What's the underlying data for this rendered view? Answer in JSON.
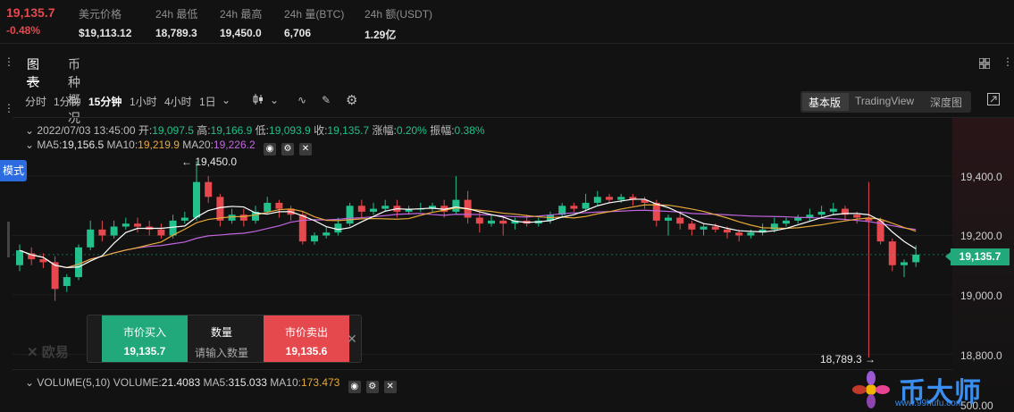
{
  "ticker": {
    "last_price": "19,135.7",
    "change_pct": "-0.48%",
    "stats": [
      {
        "label": "美元价格",
        "value": "$19,113.12"
      },
      {
        "label": "24h 最低",
        "value": "18,789.3"
      },
      {
        "label": "24h 最高",
        "value": "19,450.0"
      },
      {
        "label": "24h 量(BTC)",
        "value": "6,706"
      },
      {
        "label": "24h 额(USDT)",
        "value": "1.29亿"
      }
    ]
  },
  "tabs": [
    "图表",
    "币种概况"
  ],
  "intervals": [
    "分时",
    "1分钟",
    "15分钟",
    "1小时",
    "4小时",
    "1日"
  ],
  "view_modes": [
    "基本版",
    "TradingView",
    "深度图"
  ],
  "candle_info": {
    "datetime": "2022/07/03 13:45:00",
    "open_label": "开:",
    "open": "19,097.5",
    "high_label": "高:",
    "high": "19,166.9",
    "low_label": "低:",
    "low": "19,093.9",
    "close_label": "收:",
    "close": "19,135.7",
    "chg_label": "涨幅:",
    "chg": "0.20%",
    "amp_label": "振幅:",
    "amp": "0.38%"
  },
  "ma": {
    "ma5_label": "MA5:",
    "ma5": "19,156.5",
    "ma10_label": "MA10:",
    "ma10": "19,219.9",
    "ma20_label": "MA20:",
    "ma20": "19,226.2"
  },
  "price_axis": [
    "19,400.0",
    "19,200.0",
    "19,000.0",
    "18,800.0",
    "500.00"
  ],
  "current_price_tag": "19,135.7",
  "annotations": {
    "high": "19,450.0",
    "low": "18,789.3"
  },
  "mode_badge": "模式",
  "trade_panel": {
    "buy_label": "市价买入",
    "buy_price": "19,135.7",
    "qty_label": "数量",
    "qty_placeholder": "请输入数量",
    "sell_label": "市价卖出",
    "sell_price": "19,135.6"
  },
  "watermark": "欧易",
  "volume": {
    "title": "VOLUME(5,10)",
    "vol_label": "VOLUME:",
    "vol": "21.4083",
    "ma5_label": "MA5:",
    "ma5": "315.033",
    "ma10_label": "MA10:",
    "ma10": "173.473"
  },
  "logo": {
    "text": "币大师",
    "url": "www.99hufu.com"
  },
  "colors": {
    "up": "#21c08d",
    "down": "#e5484d",
    "ma5": "#ffffff",
    "ma10": "#e8a93a",
    "ma20": "#c266e0",
    "accent": "#2c6be0"
  },
  "chart_data": {
    "type": "candlestick",
    "interval": "15分钟",
    "ylim": [
      18789.3,
      19450.0
    ],
    "candles": [
      {
        "o": 19100,
        "c": 19150,
        "h": 19170,
        "l": 19080
      },
      {
        "o": 19140,
        "c": 19120,
        "h": 19160,
        "l": 19100
      },
      {
        "o": 19120,
        "c": 19110,
        "h": 19140,
        "l": 19090
      },
      {
        "o": 19110,
        "c": 19020,
        "h": 19130,
        "l": 18980
      },
      {
        "o": 19030,
        "c": 19060,
        "h": 19070,
        "l": 19010
      },
      {
        "o": 19060,
        "c": 19160,
        "h": 19170,
        "l": 19050
      },
      {
        "o": 19160,
        "c": 19220,
        "h": 19250,
        "l": 19150
      },
      {
        "o": 19220,
        "c": 19200,
        "h": 19250,
        "l": 19180
      },
      {
        "o": 19200,
        "c": 19230,
        "h": 19250,
        "l": 19190
      },
      {
        "o": 19230,
        "c": 19240,
        "h": 19260,
        "l": 19220
      },
      {
        "o": 19240,
        "c": 19230,
        "h": 19260,
        "l": 19210
      },
      {
        "o": 19230,
        "c": 19220,
        "h": 19250,
        "l": 19200
      },
      {
        "o": 19220,
        "c": 19200,
        "h": 19240,
        "l": 19190
      },
      {
        "o": 19200,
        "c": 19250,
        "h": 19270,
        "l": 19190
      },
      {
        "o": 19250,
        "c": 19260,
        "h": 19280,
        "l": 19240
      },
      {
        "o": 19260,
        "c": 19380,
        "h": 19450,
        "l": 19250
      },
      {
        "o": 19380,
        "c": 19330,
        "h": 19400,
        "l": 19310
      },
      {
        "o": 19330,
        "c": 19250,
        "h": 19340,
        "l": 19230
      },
      {
        "o": 19250,
        "c": 19270,
        "h": 19290,
        "l": 19240
      },
      {
        "o": 19270,
        "c": 19250,
        "h": 19290,
        "l": 19230
      },
      {
        "o": 19250,
        "c": 19280,
        "h": 19300,
        "l": 19240
      },
      {
        "o": 19280,
        "c": 19310,
        "h": 19330,
        "l": 19270
      },
      {
        "o": 19310,
        "c": 19290,
        "h": 19320,
        "l": 19260
      },
      {
        "o": 19290,
        "c": 19270,
        "h": 19300,
        "l": 19250
      },
      {
        "o": 19270,
        "c": 19180,
        "h": 19280,
        "l": 19170
      },
      {
        "o": 19180,
        "c": 19200,
        "h": 19210,
        "l": 19170
      },
      {
        "o": 19200,
        "c": 19210,
        "h": 19230,
        "l": 19190
      },
      {
        "o": 19210,
        "c": 19240,
        "h": 19260,
        "l": 19200
      },
      {
        "o": 19240,
        "c": 19300,
        "h": 19310,
        "l": 19230
      },
      {
        "o": 19300,
        "c": 19280,
        "h": 19320,
        "l": 19260
      },
      {
        "o": 19280,
        "c": 19290,
        "h": 19310,
        "l": 19270
      },
      {
        "o": 19290,
        "c": 19300,
        "h": 19320,
        "l": 19280
      },
      {
        "o": 19300,
        "c": 19280,
        "h": 19320,
        "l": 19260
      },
      {
        "o": 19280,
        "c": 19290,
        "h": 19300,
        "l": 19270
      },
      {
        "o": 19290,
        "c": 19290,
        "h": 19310,
        "l": 19280
      },
      {
        "o": 19290,
        "c": 19300,
        "h": 19310,
        "l": 19280
      },
      {
        "o": 19300,
        "c": 19280,
        "h": 19320,
        "l": 19260
      },
      {
        "o": 19280,
        "c": 19320,
        "h": 19400,
        "l": 19270
      },
      {
        "o": 19320,
        "c": 19260,
        "h": 19350,
        "l": 19240
      },
      {
        "o": 19260,
        "c": 19240,
        "h": 19280,
        "l": 19210
      },
      {
        "o": 19240,
        "c": 19250,
        "h": 19270,
        "l": 19230
      },
      {
        "o": 19250,
        "c": 19240,
        "h": 19260,
        "l": 19200
      },
      {
        "o": 19240,
        "c": 19250,
        "h": 19260,
        "l": 19220
      },
      {
        "o": 19250,
        "c": 19240,
        "h": 19270,
        "l": 19230
      },
      {
        "o": 19240,
        "c": 19250,
        "h": 19260,
        "l": 19230
      },
      {
        "o": 19250,
        "c": 19270,
        "h": 19280,
        "l": 19240
      },
      {
        "o": 19270,
        "c": 19300,
        "h": 19310,
        "l": 19260
      },
      {
        "o": 19300,
        "c": 19290,
        "h": 19310,
        "l": 19280
      },
      {
        "o": 19290,
        "c": 19310,
        "h": 19340,
        "l": 19280
      },
      {
        "o": 19310,
        "c": 19330,
        "h": 19350,
        "l": 19300
      },
      {
        "o": 19330,
        "c": 19320,
        "h": 19340,
        "l": 19310
      },
      {
        "o": 19320,
        "c": 19330,
        "h": 19340,
        "l": 19310
      },
      {
        "o": 19330,
        "c": 19320,
        "h": 19340,
        "l": 19300
      },
      {
        "o": 19320,
        "c": 19310,
        "h": 19330,
        "l": 19290
      },
      {
        "o": 19310,
        "c": 19250,
        "h": 19320,
        "l": 19230
      },
      {
        "o": 19250,
        "c": 19260,
        "h": 19270,
        "l": 19200
      },
      {
        "o": 19260,
        "c": 19240,
        "h": 19280,
        "l": 19220
      },
      {
        "o": 19240,
        "c": 19220,
        "h": 19250,
        "l": 19200
      },
      {
        "o": 19220,
        "c": 19230,
        "h": 19240,
        "l": 19200
      },
      {
        "o": 19230,
        "c": 19220,
        "h": 19240,
        "l": 19210
      },
      {
        "o": 19220,
        "c": 19210,
        "h": 19230,
        "l": 19190
      },
      {
        "o": 19210,
        "c": 19200,
        "h": 19220,
        "l": 19180
      },
      {
        "o": 19200,
        "c": 19210,
        "h": 19220,
        "l": 19190
      },
      {
        "o": 19210,
        "c": 19220,
        "h": 19240,
        "l": 19200
      },
      {
        "o": 19220,
        "c": 19240,
        "h": 19260,
        "l": 19210
      },
      {
        "o": 19240,
        "c": 19250,
        "h": 19260,
        "l": 19230
      },
      {
        "o": 19250,
        "c": 19260,
        "h": 19270,
        "l": 19240
      },
      {
        "o": 19260,
        "c": 19270,
        "h": 19290,
        "l": 19250
      },
      {
        "o": 19270,
        "c": 19280,
        "h": 19300,
        "l": 19260
      },
      {
        "o": 19280,
        "c": 19290,
        "h": 19310,
        "l": 19270
      },
      {
        "o": 19290,
        "c": 19270,
        "h": 19300,
        "l": 19250
      },
      {
        "o": 19270,
        "c": 19260,
        "h": 19280,
        "l": 19240
      },
      {
        "o": 19260,
        "c": 19250,
        "h": 19380,
        "l": 18789.3
      },
      {
        "o": 19250,
        "c": 19180,
        "h": 19260,
        "l": 19170
      },
      {
        "o": 19180,
        "c": 19100,
        "h": 19190,
        "l": 19080
      },
      {
        "o": 19100,
        "c": 19110,
        "h": 19120,
        "l": 19060
      },
      {
        "o": 19110,
        "c": 19135.7,
        "h": 19166.9,
        "l": 19093.9
      }
    ]
  }
}
